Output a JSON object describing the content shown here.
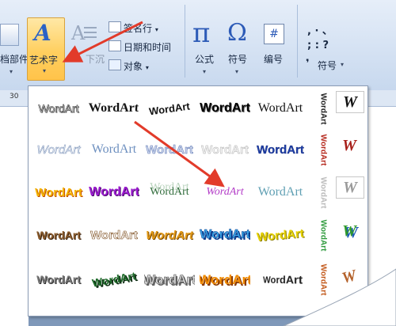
{
  "ribbon": {
    "parts_label": "档部件",
    "wordart_label": "艺术字",
    "dropcap_label": "下沉",
    "signature_label": "签名行",
    "datetime_label": "日期和时间",
    "object_label": "对象",
    "formula_label": "公式",
    "symbol_label": "符号",
    "number_label": "编号",
    "special_symbol_label": "符号",
    "pi_glyph": "π",
    "omega_glyph": "Ω",
    "number_glyph": "#",
    "wordart_glyph": "A",
    "caret_glyph": "▾",
    "punct_row1": ",  ·  、",
    "punct_row2": ";  :  ?",
    "punct_bullet": "❜"
  },
  "ruler": {
    "mark": "30"
  },
  "gallery": {
    "word": "WordArt",
    "w_letter": "W"
  }
}
